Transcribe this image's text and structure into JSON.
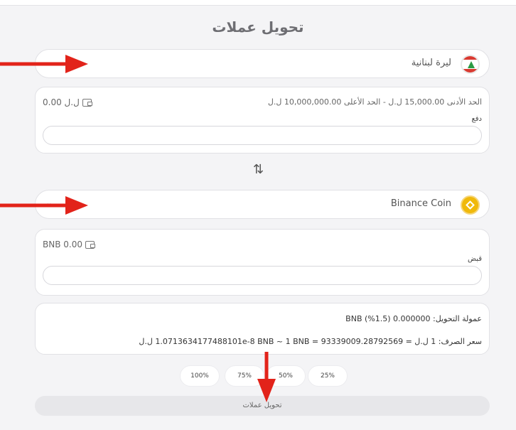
{
  "page": {
    "title": "تحويل عملات"
  },
  "from": {
    "currency_label": "ليرة لبنانية",
    "icon": "lebanon-flag-icon",
    "balance": "0.00 ل.ل",
    "limits": "الحد الأدنى 15,000.00 ل.ل   -   الحد الأعلى 10,000,000.00 ل.ل",
    "field_label": "دفع",
    "value": ""
  },
  "swap": {
    "glyph": "⇅",
    "icon": "swap-arrows-icon"
  },
  "to": {
    "currency_label": "Binance Coin",
    "icon": "binance-coin-icon",
    "balance": "BNB 0.00",
    "field_label": "قبض",
    "value": ""
  },
  "info": {
    "fee": "عمولة التحويل: 0.000000 BNB (%1.5)",
    "rate": "سعر الصرف: 1 ل.ل = 1.0713634177488101e-8 BNB ~ 1 BNB = 93339009.28792569 ل.ل"
  },
  "percent_buttons": [
    "100%",
    "75%",
    "50%",
    "25%"
  ],
  "submit_label": "تحويل عملات",
  "colors": {
    "arrow": "#e2231a",
    "accent_coin": "#f0b90b"
  }
}
